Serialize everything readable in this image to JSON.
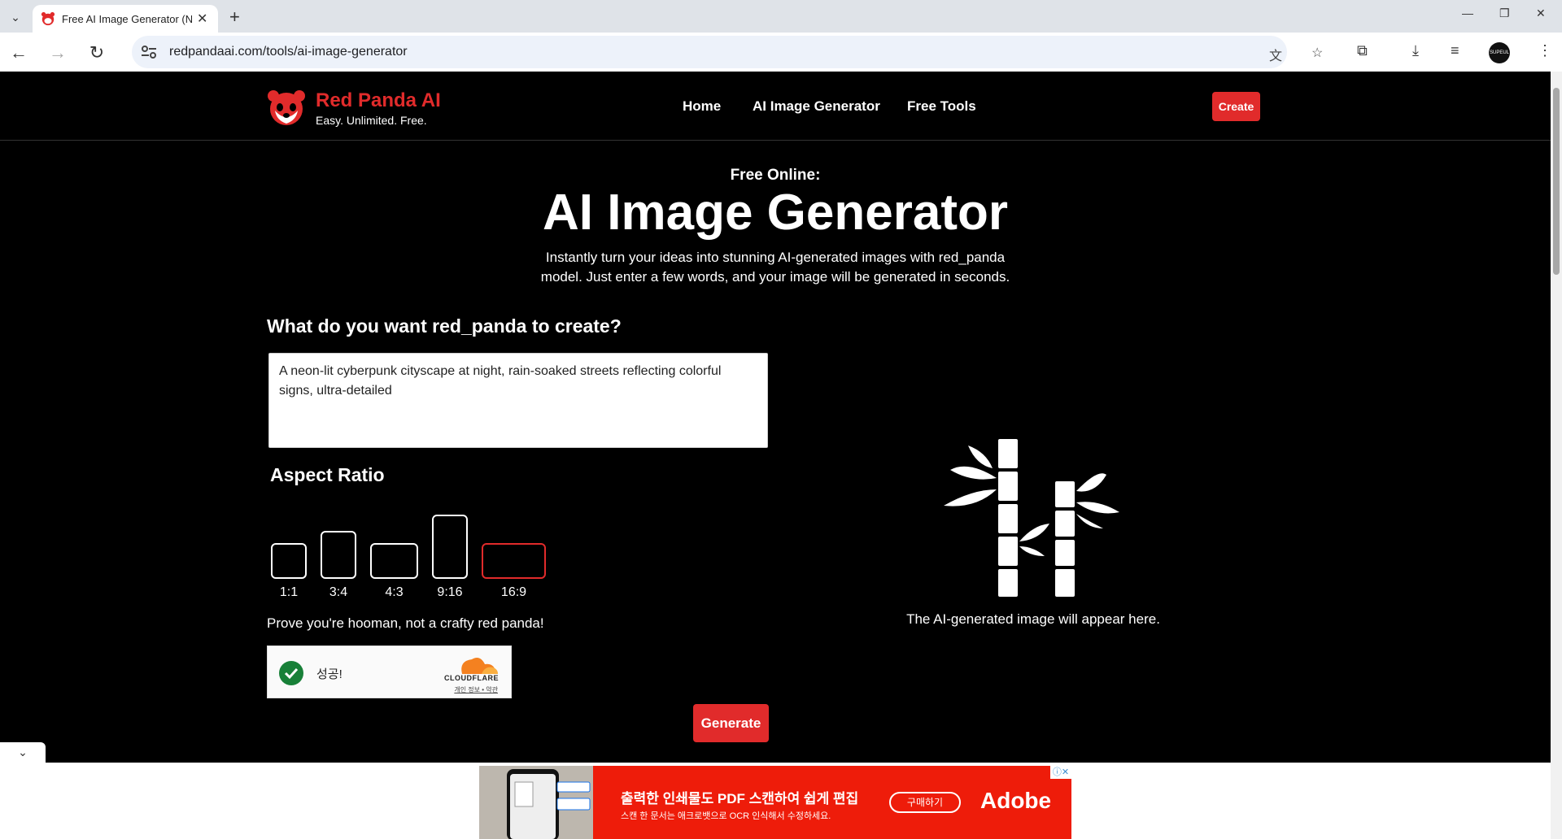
{
  "browser": {
    "tab_title": "Free AI Image Generator (N",
    "url": "redpandaai.com/tools/ai-image-generator",
    "profile_label": "SUPEUL"
  },
  "site": {
    "brand": "Red Panda AI",
    "tagline": "Easy. Unlimited. Free.",
    "nav": [
      "Home",
      "AI Image Generator",
      "Free Tools"
    ],
    "cta": "Create"
  },
  "hero": {
    "kicker": "Free Online:",
    "title": "AI Image Generator",
    "lead": "Instantly turn your ideas into stunning AI-generated images with red_panda model. Just enter a few words, and your image will be generated in seconds."
  },
  "form": {
    "question": "What do you want red_panda to create?",
    "prompt_value": "A neon-lit cyberpunk cityscape at night, rain-soaked streets reflecting colorful signs, ultra-detailed",
    "aspect_title": "Aspect Ratio",
    "aspect_ratios": [
      "1:1",
      "3:4",
      "4:3",
      "9:16",
      "16:9"
    ],
    "selected_ratio": "16:9",
    "captcha_prompt": "Prove you're hooman, not a crafty red panda!",
    "captcha_status": "성공!",
    "captcha_brand": "CLOUDFLARE",
    "captcha_links": "개인 정보 • 약관",
    "generate": "Generate"
  },
  "preview": {
    "placeholder": "The AI-generated image will appear here."
  },
  "ad": {
    "title": "출력한 인쇄물도 PDF 스캔하여 쉽게 편집",
    "subtitle": "스캔 한 문서는 애크로뱃으로 OCR 인식해서 수정하세요.",
    "button": "구매하기",
    "brand": "Adobe"
  },
  "colors": {
    "accent": "#e12b2b",
    "background": "#000000"
  }
}
